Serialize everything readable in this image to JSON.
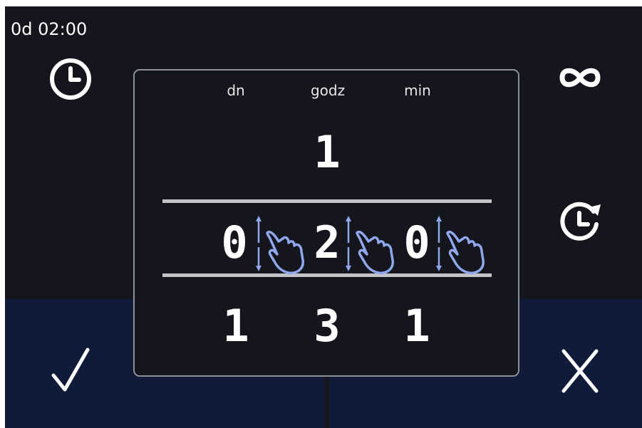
{
  "status": {
    "timer_text": "0d 02:00"
  },
  "icons": {
    "clock": "clock-icon",
    "infinity": "infinity-icon",
    "repeat_clock": "clock-refresh-icon",
    "confirm": "check-icon",
    "cancel": "close-icon",
    "swipe_hint": "swipe-hand-icon"
  },
  "picker": {
    "columns": [
      "dn",
      "godz",
      "min"
    ],
    "above": [
      "",
      "1",
      ""
    ],
    "selected": [
      "0",
      "2",
      "0"
    ],
    "below": [
      "1",
      "3",
      "1"
    ]
  },
  "colors": {
    "background": "#14151d",
    "bottom_panel": "#0f1b38",
    "dialog_border": "#8e9098",
    "accent_hand": "#8fa7ec"
  }
}
